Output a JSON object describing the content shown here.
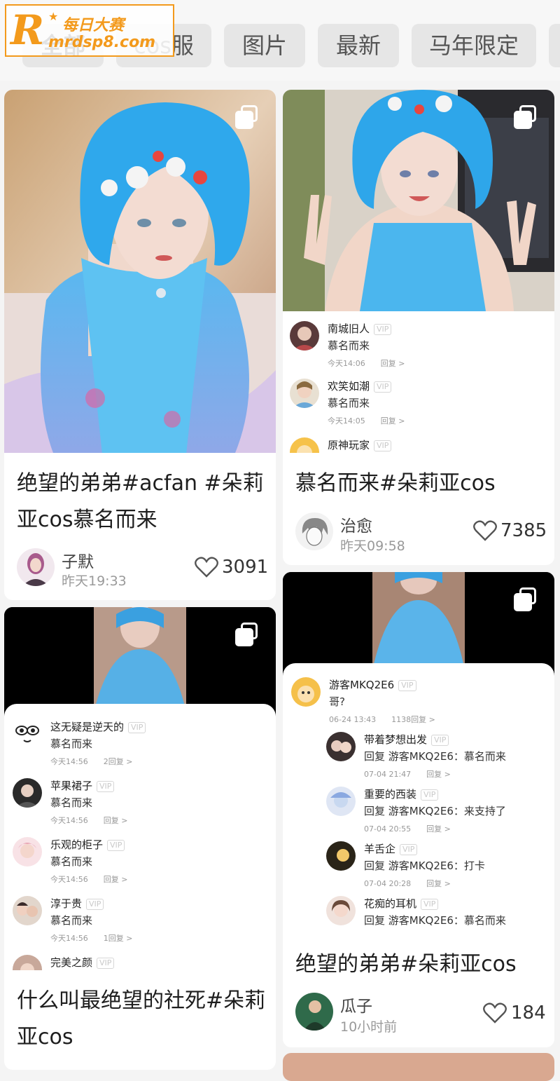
{
  "tabs": [
    {
      "label": "全部",
      "active": true
    },
    {
      "label": "cos服",
      "active": false
    },
    {
      "label": "图片",
      "active": false
    },
    {
      "label": "最新",
      "active": false
    },
    {
      "label": "马年限定",
      "active": false
    }
  ],
  "watermark": {
    "logo": "R",
    "title": "每日大赛",
    "url": "mrdsp8.com"
  },
  "cards": [
    {
      "title": "绝望的弟弟#acfan #朵莉亚cos慕名而来",
      "author": "子默",
      "time": "昨天19:33",
      "likes": "3091"
    },
    {
      "title": "慕名而来#朵莉亚cos",
      "author": "治愈",
      "time": "昨天09:58",
      "likes": "7385",
      "comments": [
        {
          "name": "南城旧人",
          "vip": "VIP",
          "text": "慕名而来",
          "time": "今天14:06",
          "reply": "回复 >"
        },
        {
          "name": "欢笑如潮",
          "vip": "VIP",
          "text": "慕名而来",
          "time": "今天14:05",
          "reply": "回复 >"
        },
        {
          "name": "原神玩家",
          "vip": "VIP"
        }
      ]
    },
    {
      "title": "什么叫最绝望的社死#朵莉亚cos",
      "comments": [
        {
          "name": "这无疑是逆天的",
          "vip": "VIP",
          "text": "慕名而来",
          "time": "今天14:56",
          "reply": "2回复 >"
        },
        {
          "name": "苹果裙子",
          "vip": "VIP",
          "text": "慕名而来",
          "time": "今天14:56",
          "reply": "回复 >"
        },
        {
          "name": "乐观的柜子",
          "vip": "VIP",
          "text": "慕名而来",
          "time": "今天14:56",
          "reply": "回复 >"
        },
        {
          "name": "淳于贵",
          "vip": "VIP",
          "text": "慕名而来",
          "time": "今天14:56",
          "reply": "1回复 >"
        },
        {
          "name": "完美之颜",
          "vip": "VIP"
        }
      ]
    },
    {
      "title": "绝望的弟弟#朵莉亚cos",
      "author": "瓜子",
      "time": "10小时前",
      "likes": "184",
      "main_comment": {
        "name": "游客MKQ2E6",
        "vip": "VIP",
        "text": "哥?",
        "time": "06-24 13:43",
        "reply": "1138回复 >"
      },
      "replies": [
        {
          "name": "带着梦想出发",
          "vip": "VIP",
          "text": "回复 游客MKQ2E6：慕名而来",
          "time": "07-04 21:47",
          "reply": "回复 >"
        },
        {
          "name": "重要的西装",
          "vip": "VIP",
          "text": "回复 游客MKQ2E6：来支持了",
          "time": "07-04 20:55",
          "reply": "回复 >"
        },
        {
          "name": "羊舌企",
          "vip": "VIP",
          "text": "回复 游客MKQ2E6：打卡",
          "time": "07-04 20:28",
          "reply": "回复 >"
        },
        {
          "name": "花痴的耳机",
          "vip": "VIP",
          "text": "回复 游客MKQ2E6：慕名而来"
        }
      ]
    }
  ]
}
